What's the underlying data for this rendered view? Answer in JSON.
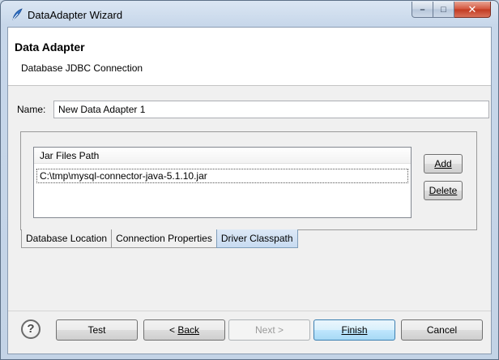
{
  "window": {
    "title": "DataAdapter Wizard",
    "minimize_glyph": "–",
    "maximize_glyph": "□",
    "close_glyph": "✕"
  },
  "header": {
    "title": "Data Adapter",
    "subtitle": "Database JDBC Connection"
  },
  "name_field": {
    "label": "Name:",
    "value": "New Data Adapter 1"
  },
  "jar_list": {
    "column_header": "Jar Files Path",
    "items": [
      "C:\\tmp\\mysql-connector-java-5.1.10.jar"
    ],
    "add_label": "Add",
    "delete_label": "Delete"
  },
  "tabs": [
    {
      "label": "Database Location",
      "active": false
    },
    {
      "label": "Connection Properties",
      "active": false
    },
    {
      "label": "Driver Classpath",
      "active": true
    }
  ],
  "footer": {
    "help_glyph": "?",
    "test_label": "Test",
    "back_prefix": "< ",
    "back_label": "Back",
    "next_label": "Next >",
    "finish_label": "Finish",
    "cancel_label": "Cancel"
  },
  "colors": {
    "frame": "#c3d3e6",
    "active_tab": "#c8dbf1",
    "default_button_border": "#3c7fb1"
  }
}
